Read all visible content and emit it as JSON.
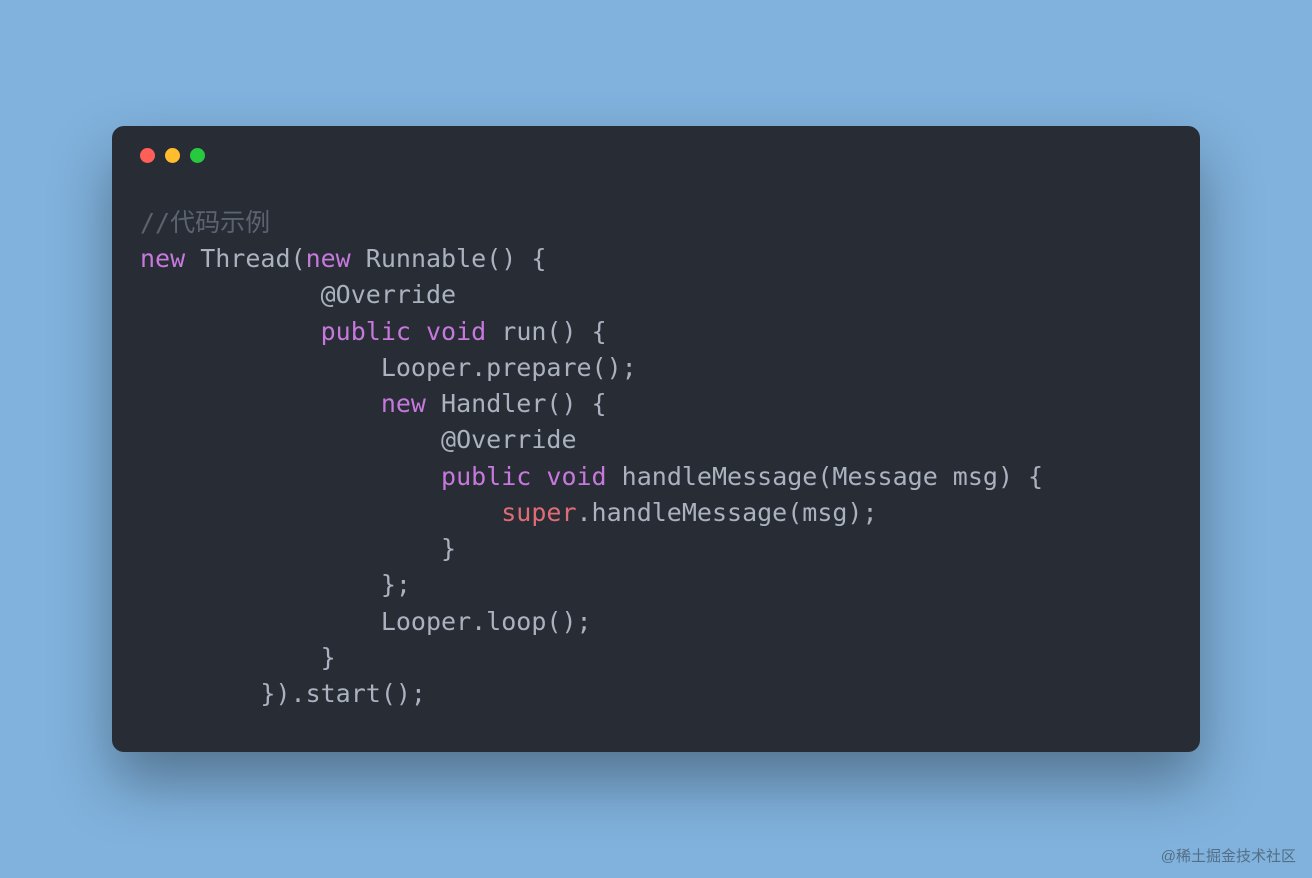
{
  "code": {
    "line1_comment": "//代码示例",
    "line2_new": "new",
    "line2_thread": " Thread(",
    "line2_new2": "new",
    "line2_runnable": " Runnable() {",
    "line3_indent": "            ",
    "line3_override": "@Override",
    "line4_indent": "            ",
    "line4_public": "public",
    "line4_space1": " ",
    "line4_void": "void",
    "line4_run": " run() {",
    "line5_indent": "                ",
    "line5_looper": "Looper.prepare();",
    "line6_indent": "                ",
    "line6_new": "new",
    "line6_handler": " Handler() {",
    "line7_indent": "                    ",
    "line7_override": "@Override",
    "line8_indent": "                    ",
    "line8_public": "public",
    "line8_space1": " ",
    "line8_void": "void",
    "line8_handle": " handleMessage(Message msg) {",
    "line9_indent": "                        ",
    "line9_super": "super",
    "line9_rest": ".handleMessage(msg);",
    "line10_indent": "                    ",
    "line10_close": "}",
    "line11_indent": "                ",
    "line11_close": "};",
    "line12_indent": "                ",
    "line12_looper": "Looper.loop();",
    "line13_indent": "            ",
    "line13_close": "}",
    "line14_indent": "        ",
    "line14_close": "}).start();"
  },
  "watermark": "@稀土掘金技术社区"
}
